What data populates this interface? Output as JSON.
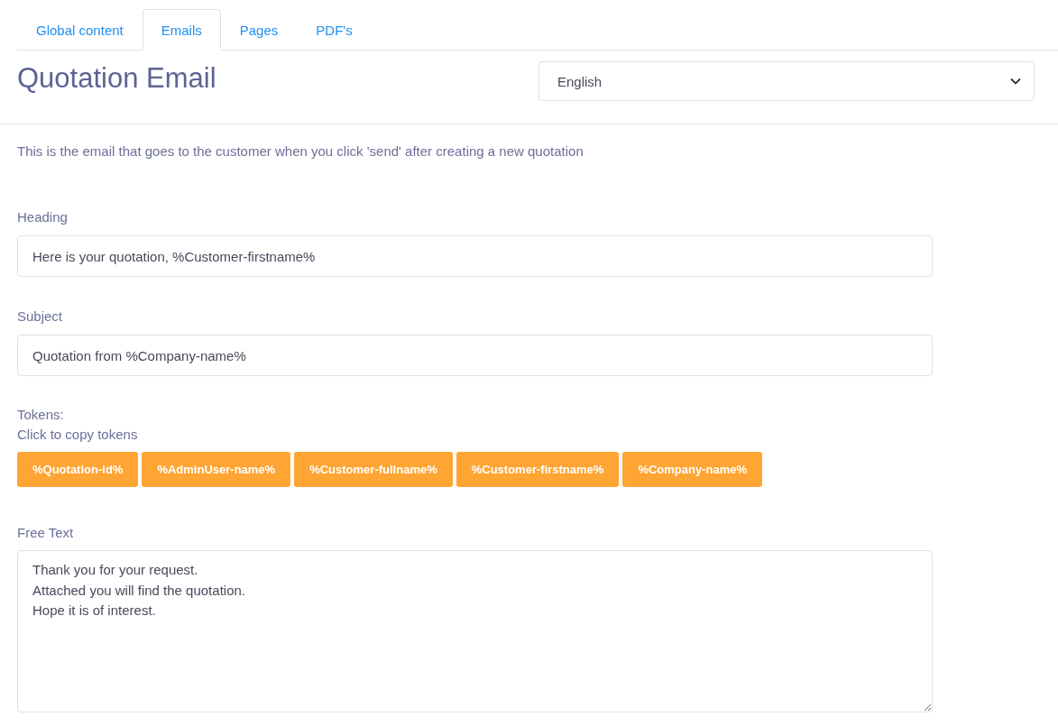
{
  "tabs": [
    {
      "label": "Global content",
      "selected": false
    },
    {
      "label": "Emails",
      "selected": true
    },
    {
      "label": "Pages",
      "selected": false
    },
    {
      "label": "PDF's",
      "selected": false
    }
  ],
  "title": "Quotation Email",
  "language_select": {
    "value": "English"
  },
  "description": "This is the email that goes to the customer when you click 'send' after creating a new quotation",
  "fields": [
    {
      "label": "Heading",
      "value": "Here is your quotation, %Customer-firstname%"
    },
    {
      "label": "Subject",
      "value": "Quotation from %Company-name%"
    }
  ],
  "tokens": {
    "label": "Tokens:",
    "hint": "Click to copy tokens",
    "items": [
      "%Quotation-id%",
      "%AdminUser-name%",
      "%Customer-fullname%",
      "%Customer-firstname%",
      "%Company-name%"
    ]
  },
  "free_text": {
    "label": "Free Text",
    "value": "Thank you for your request.\nAttached you will find the quotation.\nHope it is of interest."
  }
}
